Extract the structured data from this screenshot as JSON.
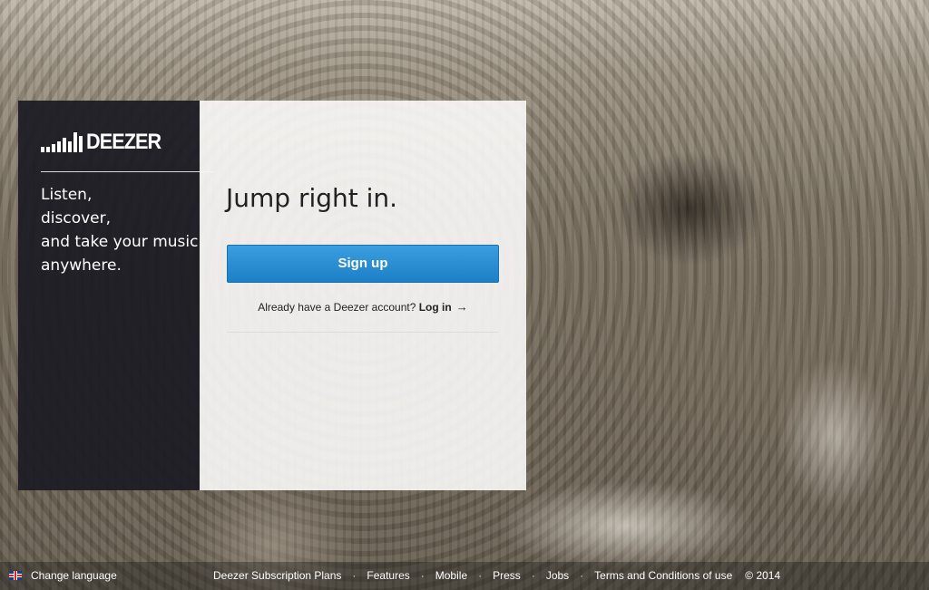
{
  "brand": {
    "logo_text": "DEEZER",
    "tagline": "Listen,\ndiscover,\nand take your music\nanywhere."
  },
  "signup": {
    "headline": "Jump right in.",
    "signup_button": "Sign up",
    "login_prompt": "Already have a Deezer account?",
    "login_link": "Log in",
    "accent_color": "#2a8fd6"
  },
  "footer": {
    "change_language": "Change language",
    "links": [
      "Deezer Subscription Plans",
      "Features",
      "Mobile",
      "Press",
      "Jobs",
      "Terms and Conditions of use"
    ],
    "separator": "·",
    "copyright": "© 2014"
  },
  "icons": {
    "logo": "equalizer-bars-icon",
    "login_arrow": "arrow-right-icon",
    "language_flag": "uk-flag-icon"
  }
}
